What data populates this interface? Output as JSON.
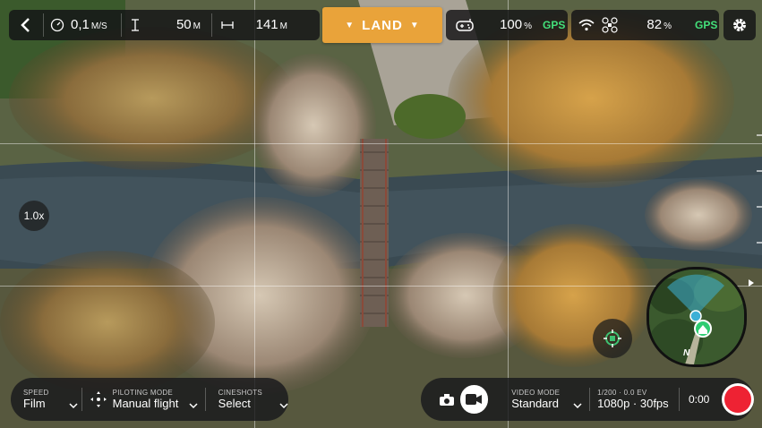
{
  "colors": {
    "land_accent": "#e9a33a",
    "gps_green": "#43e07a",
    "record_red": "#ee2233"
  },
  "top_bar": {
    "back_icon": "chevron-left-icon",
    "speed": {
      "icon": "speedometer-icon",
      "value": "0,1",
      "unit": "M/S"
    },
    "altitude": {
      "icon": "altitude-icon",
      "value": "50",
      "unit": "M"
    },
    "distance": {
      "icon": "distance-icon",
      "value": "141",
      "unit": "M"
    },
    "land_label": "LAND",
    "controller": {
      "icon": "gamepad-icon",
      "battery": "100",
      "unit": "%",
      "gps": "GPS"
    },
    "drone": {
      "wifi_icon": "wifi-icon",
      "drone_icon": "drone-icon",
      "battery": "82",
      "unit": "%",
      "gps": "GPS"
    },
    "settings_icon": "gear-icon"
  },
  "zoom_label": "1.0x",
  "bottom_left": {
    "speed": {
      "label": "SPEED",
      "value": "Film"
    },
    "piloting_mode": {
      "label": "PILOTING MODE",
      "value": "Manual flight"
    },
    "cineshots": {
      "label": "CINESHOTS",
      "value": "Select"
    }
  },
  "bottom_right": {
    "mode_icons": [
      "camera-icon",
      "video-icon"
    ],
    "video_mode": {
      "label": "VIDEO MODE",
      "value": "Standard"
    },
    "exposure": {
      "label": "1/200 · 0.0 EV",
      "value": "1080p · 30fps"
    },
    "timer": "0:00"
  },
  "minimap": {
    "north_label": "N"
  }
}
